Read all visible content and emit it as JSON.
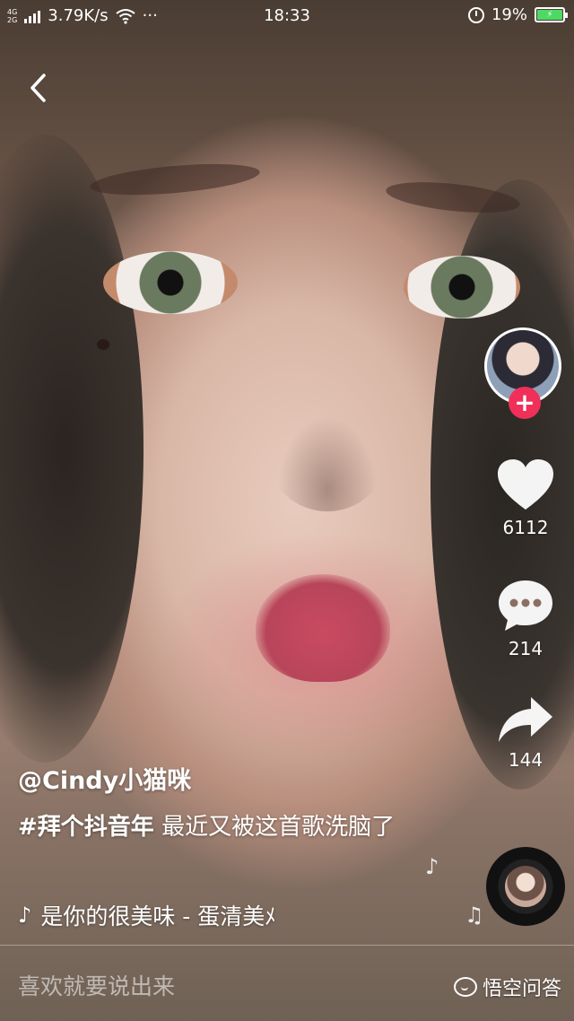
{
  "status_bar": {
    "network_type_top": "4G",
    "network_type_bottom": "2G",
    "speed": "3.79K/s",
    "more": "···",
    "time": "18:33",
    "battery": "19%"
  },
  "video": {
    "author": "@Cindy小猫咪",
    "hashtag": "#拜个抖音年",
    "caption": "最近又被这首歌洗脑了",
    "music": "是你的很美味 - 蛋清美ﾒ"
  },
  "actions": {
    "likes": "6112",
    "comments": "214",
    "shares": "144"
  },
  "comment_bar": {
    "placeholder": "喜欢就要说出来"
  },
  "watermark": "悟空问答",
  "colors": {
    "follow": "#f03059",
    "battery": "#4cd964"
  },
  "icons": [
    "back-icon",
    "heart-icon",
    "comment-icon",
    "share-icon",
    "music-note-icon",
    "wifi-icon",
    "alarm-icon",
    "battery-icon"
  ]
}
